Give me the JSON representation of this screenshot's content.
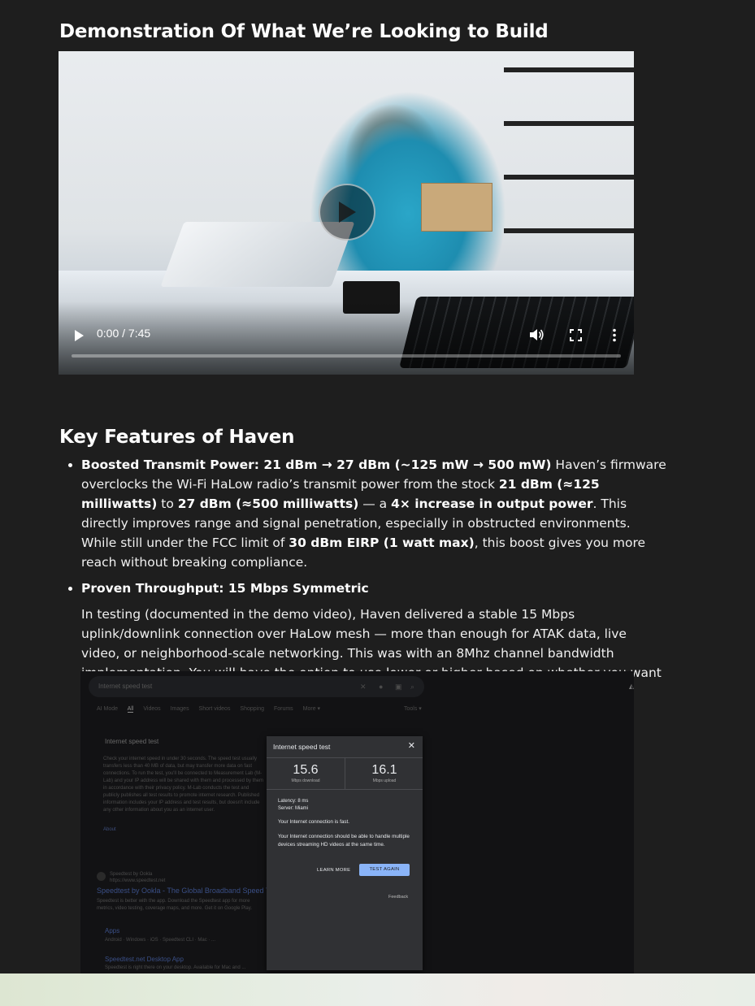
{
  "demo_section": {
    "heading": "Demonstration Of What We’re Looking to Build",
    "video": {
      "time_display": "0:00 / 7:45",
      "progress_fraction": 0
    }
  },
  "features_section": {
    "heading": "Key Features of Haven",
    "item1": {
      "title": "Boosted Transmit Power: 21 dBm → 27 dBm (~125 mW → 500 mW)",
      "t1": " Haven’s firmware overclocks the Wi-Fi HaLow radio’s transmit power from the stock ",
      "b1": "21 dBm (≈125 milliwatts)",
      "t2": " to ",
      "b2": "27 dBm (≈500 milliwatts)",
      "t3": " — a ",
      "b3": "4× increase in output power",
      "t4": ". This directly improves range and signal penetration, especially in obstructed environments. While still under the FCC limit of ",
      "b4": "30 dBm EIRP (1 watt max)",
      "t5": ", this boost gives you more reach without breaking compliance."
    },
    "item2": {
      "title": "Proven Throughput: 15 Mbps Symmetric",
      "body": "In testing (documented in the demo video), Haven delivered a stable 15 Mbps uplink/downlink connection over HaLow mesh — more than enough for ATAK data, live video, or neighborhood-scale networking. This was with an 8Mhz channel bandwidth implementation. You will have the option to use lower or higher based on whether you want to optimize for data rate or range."
    }
  },
  "speedtest_screenshot": {
    "search_query": "Internet speed test",
    "filters": [
      "AI Mode",
      "All",
      "Videos",
      "Images",
      "Short videos",
      "Shopping",
      "Forums",
      "More ▾"
    ],
    "tools_label": "Tools ▾",
    "bg_title": "Internet speed test",
    "bg_text": "Check your internet speed in under 30 seconds. The speed test usually transfers less than 40 MB of data, but may transfer more data on fast connections. To run the test, you'll be connected to Measurement Lab (M-Lab) and your IP address will be shared with them and processed by them in accordance with their privacy policy. M-Lab conducts the test and publicly publishes all test results to promote internet research. Published information includes your IP address and test results, but doesn't include any other information about you as an internet user.",
    "bg_link": "About",
    "bg_site": "Speedtest by Ookla\nhttps://www.speedtest.net",
    "bg_result_title": "Speedtest by Ookla - The Global Broadband Speed Test",
    "bg_result_desc": "Speedtest is better with the app. Download the Speedtest app for more metrics, video testing, coverage maps, and more. Get it on Google Play.",
    "bg_apps": "Apps",
    "bg_apps_sub": "Android · Windows · iOS · Speedtest CLI · Mac · ...",
    "bg_desktop": "Speedtest.net Desktop App",
    "bg_desktop_sub": "Speedtest is right there on your desktop. Available for Mac and ...",
    "dialog": {
      "title": "Internet speed test",
      "close_glyph": "✕",
      "download_value": "15.6",
      "download_label": "Mbps download",
      "upload_value": "16.1",
      "upload_label": "Mbps upload",
      "latency": "Latency: 8 ms",
      "server": "Server: Miami",
      "fast_msg": "Your Internet connection is fast.",
      "detail_msg": "Your Internet connection should be able to handle multiple devices streaming HD videos at the same time.",
      "learn_more": "LEARN MORE",
      "test_again": "TEST AGAIN",
      "feedback": "Feedback"
    }
  },
  "colors": {
    "page_bg": "#1e1e1e",
    "dialog_bg": "#303134",
    "button_blue": "#8ab4f8"
  }
}
